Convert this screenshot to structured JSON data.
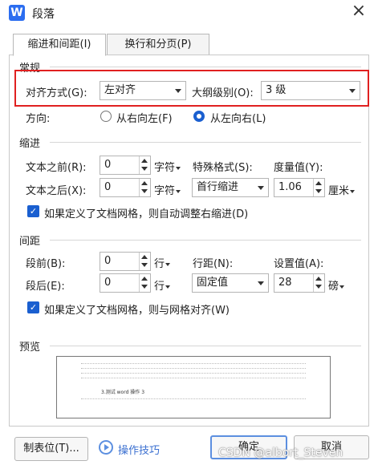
{
  "window": {
    "title": "段落",
    "app_icon_letter": "W"
  },
  "tabs": [
    {
      "label": "缩进和间距(I)",
      "active": true
    },
    {
      "label": "换行和分页(P)",
      "active": false
    }
  ],
  "general": {
    "header": "常规",
    "align_label": "对齐方式(G):",
    "align_value": "左对齐",
    "outline_label": "大纲级别(O):",
    "outline_value": "3 级",
    "direction_label": "方向:",
    "rtl_label": "从右向左(F)",
    "ltr_label": "从左向右(L)",
    "direction_selected": "ltr"
  },
  "indent": {
    "header": "缩进",
    "before_label": "文本之前(R):",
    "before_value": "0",
    "before_unit": "字符",
    "after_label": "文本之后(X):",
    "after_value": "0",
    "after_unit": "字符",
    "special_label": "特殊格式(S):",
    "special_value": "首行缩进",
    "measure_label": "度量值(Y):",
    "measure_value": "1.06",
    "measure_unit": "厘米",
    "auto_adjust_label": "如果定义了文档网格，则自动调整右缩进(D)",
    "auto_adjust_checked": true
  },
  "spacing": {
    "header": "间距",
    "before_label": "段前(B):",
    "before_value": "0",
    "before_unit": "行",
    "after_label": "段后(E):",
    "after_value": "0",
    "after_unit": "行",
    "line_label": "行距(N):",
    "line_value": "固定值",
    "setting_label": "设置值(A):",
    "setting_value": "28",
    "setting_unit": "磅",
    "snap_grid_label": "如果定义了文档网格，则与网格对齐(W)",
    "snap_grid_checked": true
  },
  "preview": {
    "header": "预览",
    "sample_text": "3.测试 word 操作 3",
    "filler_line": "前一段落前一段落前一段落前一段落前一段落前一段落前一段落前一段落前一段落"
  },
  "buttons": {
    "tabs_button": "制表位(T)...",
    "tips_button": "操作技巧",
    "ok": "确定",
    "cancel": "取消"
  },
  "watermark": "CSDN @albort_Steven",
  "colors": {
    "accent": "#1a5fd0",
    "highlight": "#e02020",
    "app_icon": "#2b6df0"
  }
}
